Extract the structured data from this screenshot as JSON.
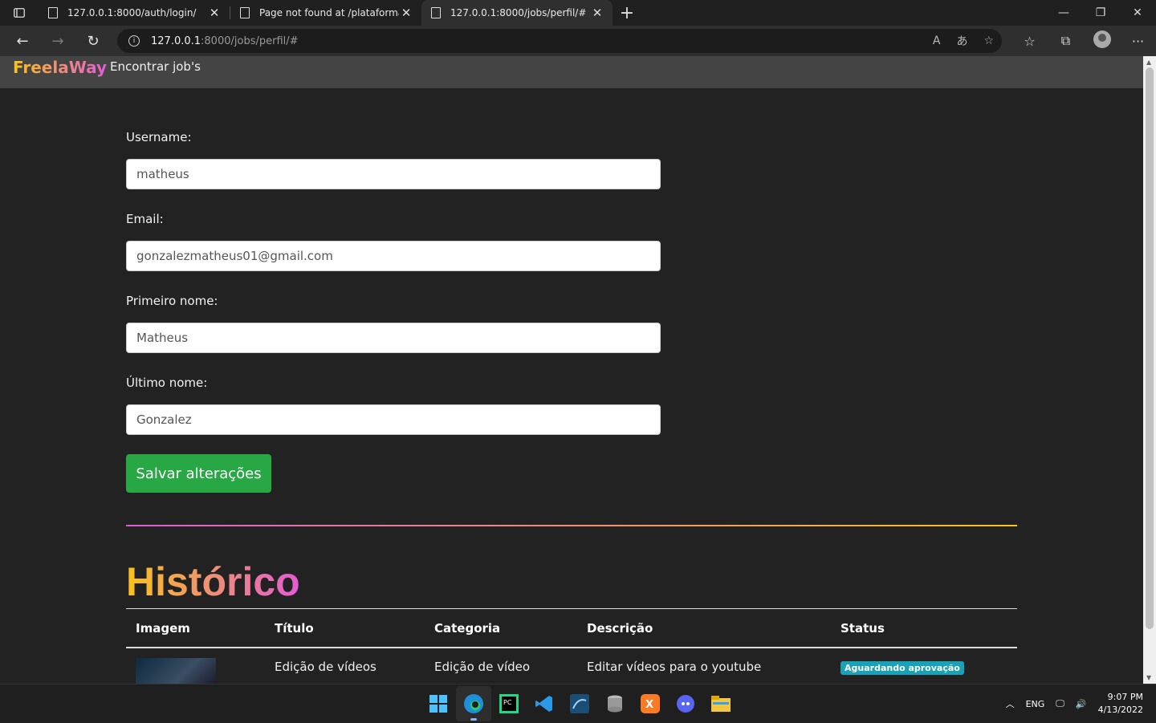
{
  "browser": {
    "tabs": [
      {
        "title": "127.0.0.1:8000/auth/login/",
        "active": false
      },
      {
        "title": "Page not found at /plataforma",
        "active": false
      },
      {
        "title": "127.0.0.1:8000/jobs/perfil/#",
        "active": true
      }
    ],
    "url_host": "127.0.0.1",
    "url_path": ":8000/jobs/perfil/#"
  },
  "navbar": {
    "brand": "FreelaWay",
    "link": "Encontrar job's"
  },
  "form": {
    "username_label": "Username:",
    "username_value": "matheus",
    "email_label": "Email:",
    "email_value": "gonzalezmatheus01@gmail.com",
    "first_name_label": "Primeiro nome:",
    "first_name_value": "Matheus",
    "last_name_label": "Último nome:",
    "last_name_value": "Gonzalez",
    "save_label": "Salvar alterações"
  },
  "history": {
    "title": "Histórico",
    "columns": [
      "Imagem",
      "Título",
      "Categoria",
      "Descrição",
      "Status"
    ],
    "rows": [
      {
        "titulo": "Edição de vídeos",
        "categoria": "Edição de vídeo",
        "descricao": "Editar vídeos para o youtube",
        "status": "Aguardando aprovação"
      }
    ]
  },
  "colors": {
    "brand_gradient_start": "#f9c31a",
    "brand_gradient_end": "#e35bd4",
    "save_button": "#28a745",
    "status_badge": "#17a2b8"
  },
  "taskbar": {
    "icons": [
      "windows-start-icon",
      "edge-icon",
      "pycharm-icon",
      "vscode-icon",
      "mysql-workbench-icon",
      "database-icon",
      "xampp-icon",
      "discord-icon",
      "file-explorer-icon"
    ],
    "lang": "ENG",
    "time": "9:07 PM",
    "date": "4/13/2022"
  }
}
